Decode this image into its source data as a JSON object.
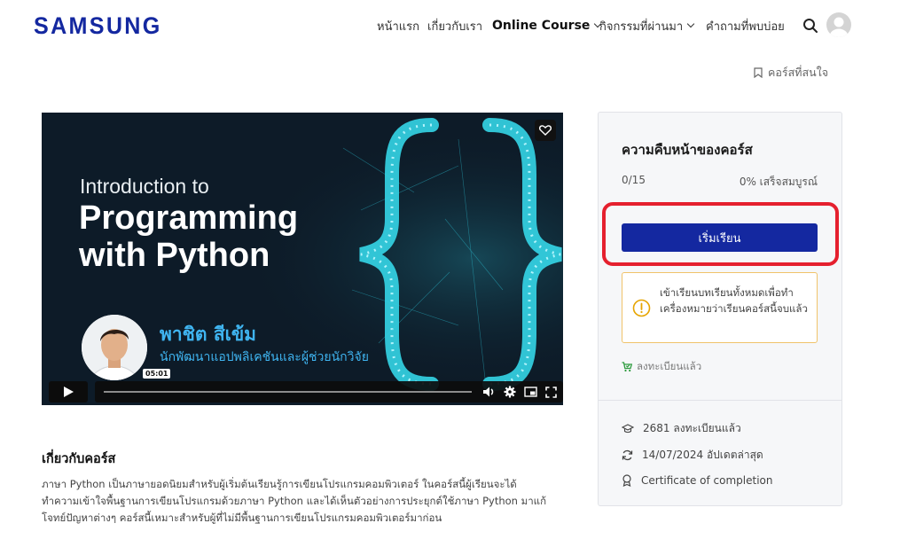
{
  "header": {
    "logo": "SAMSUNG",
    "nav": [
      {
        "label": "หน้าแรก"
      },
      {
        "label": "เกี่ยวกับเรา"
      },
      {
        "label": "Online Course"
      },
      {
        "label": "กิจกรรมที่ผ่านมา"
      },
      {
        "label": "คำถามที่พบบ่อย"
      }
    ],
    "wishlist_label": "คอร์สที่สนใจ"
  },
  "video": {
    "intro_line": "Introduction to",
    "title_line1": "Programming",
    "title_line2": "with Python",
    "presenter_name": "พาชิต สีเข้ม",
    "presenter_role": "นักพัฒนาแอปพลิเคชันและผู้ช่วยนักวิจัย",
    "time_tooltip": "05:01"
  },
  "about": {
    "title": "เกี่ยวกับคอร์ส",
    "lines": [
      "ภาษา Python เป็นภาษายอดนิยมสำหรับผู้เริ่มต้นเรียนรู้การเขียนโปรแกรมคอมพิวเตอร์ ในคอร์สนี้ผู้เรียนจะได้",
      "ทำความเข้าใจพื้นฐานการเขียนโปรแกรมด้วยภาษา Python และได้เห็นตัวอย่างการประยุกต์ใช้ภาษา Python มาแก้",
      "โจทย์ปัญหาต่างๆ คอร์สนี้เหมาะสำหรับผู้ที่ไม่มีพื้นฐานการเขียนโปรแกรมคอมพิวเตอร์มาก่อน"
    ]
  },
  "progress_card": {
    "title": "ความคืบหน้าของคอร์ส",
    "lesson_count": "0/15",
    "percent_text": "0% เสร็จสมบูรณ์",
    "start_button": "เริ่มเรียน",
    "notice_text": "เข้าเรียนบทเรียนทั้งหมดเพื่อทำเครื่องหมายว่าเรียนคอร์สนี้จบแล้ว",
    "enrolled_label": "ลงทะเบียนแล้ว",
    "meta": {
      "students": "2681 ลงทะเบียนแล้ว",
      "updated": "14/07/2024 อัปเดตล่าสุด",
      "certificate": "Certificate of completion"
    }
  },
  "colors": {
    "brand": "#1428a0",
    "highlight": "#e5202e",
    "notice_border": "#f0c36a",
    "enrolled_green": "#2e9b3f",
    "presenter_blue": "#3fb4f0"
  },
  "icons": [
    "search-icon",
    "user-avatar-icon",
    "bookmark-icon",
    "heart-icon",
    "play-icon",
    "volume-icon",
    "settings-icon",
    "pip-icon",
    "fullscreen-icon",
    "warning-circle-icon",
    "cart-check-icon",
    "graduation-cap-icon",
    "refresh-icon",
    "certificate-icon"
  ]
}
